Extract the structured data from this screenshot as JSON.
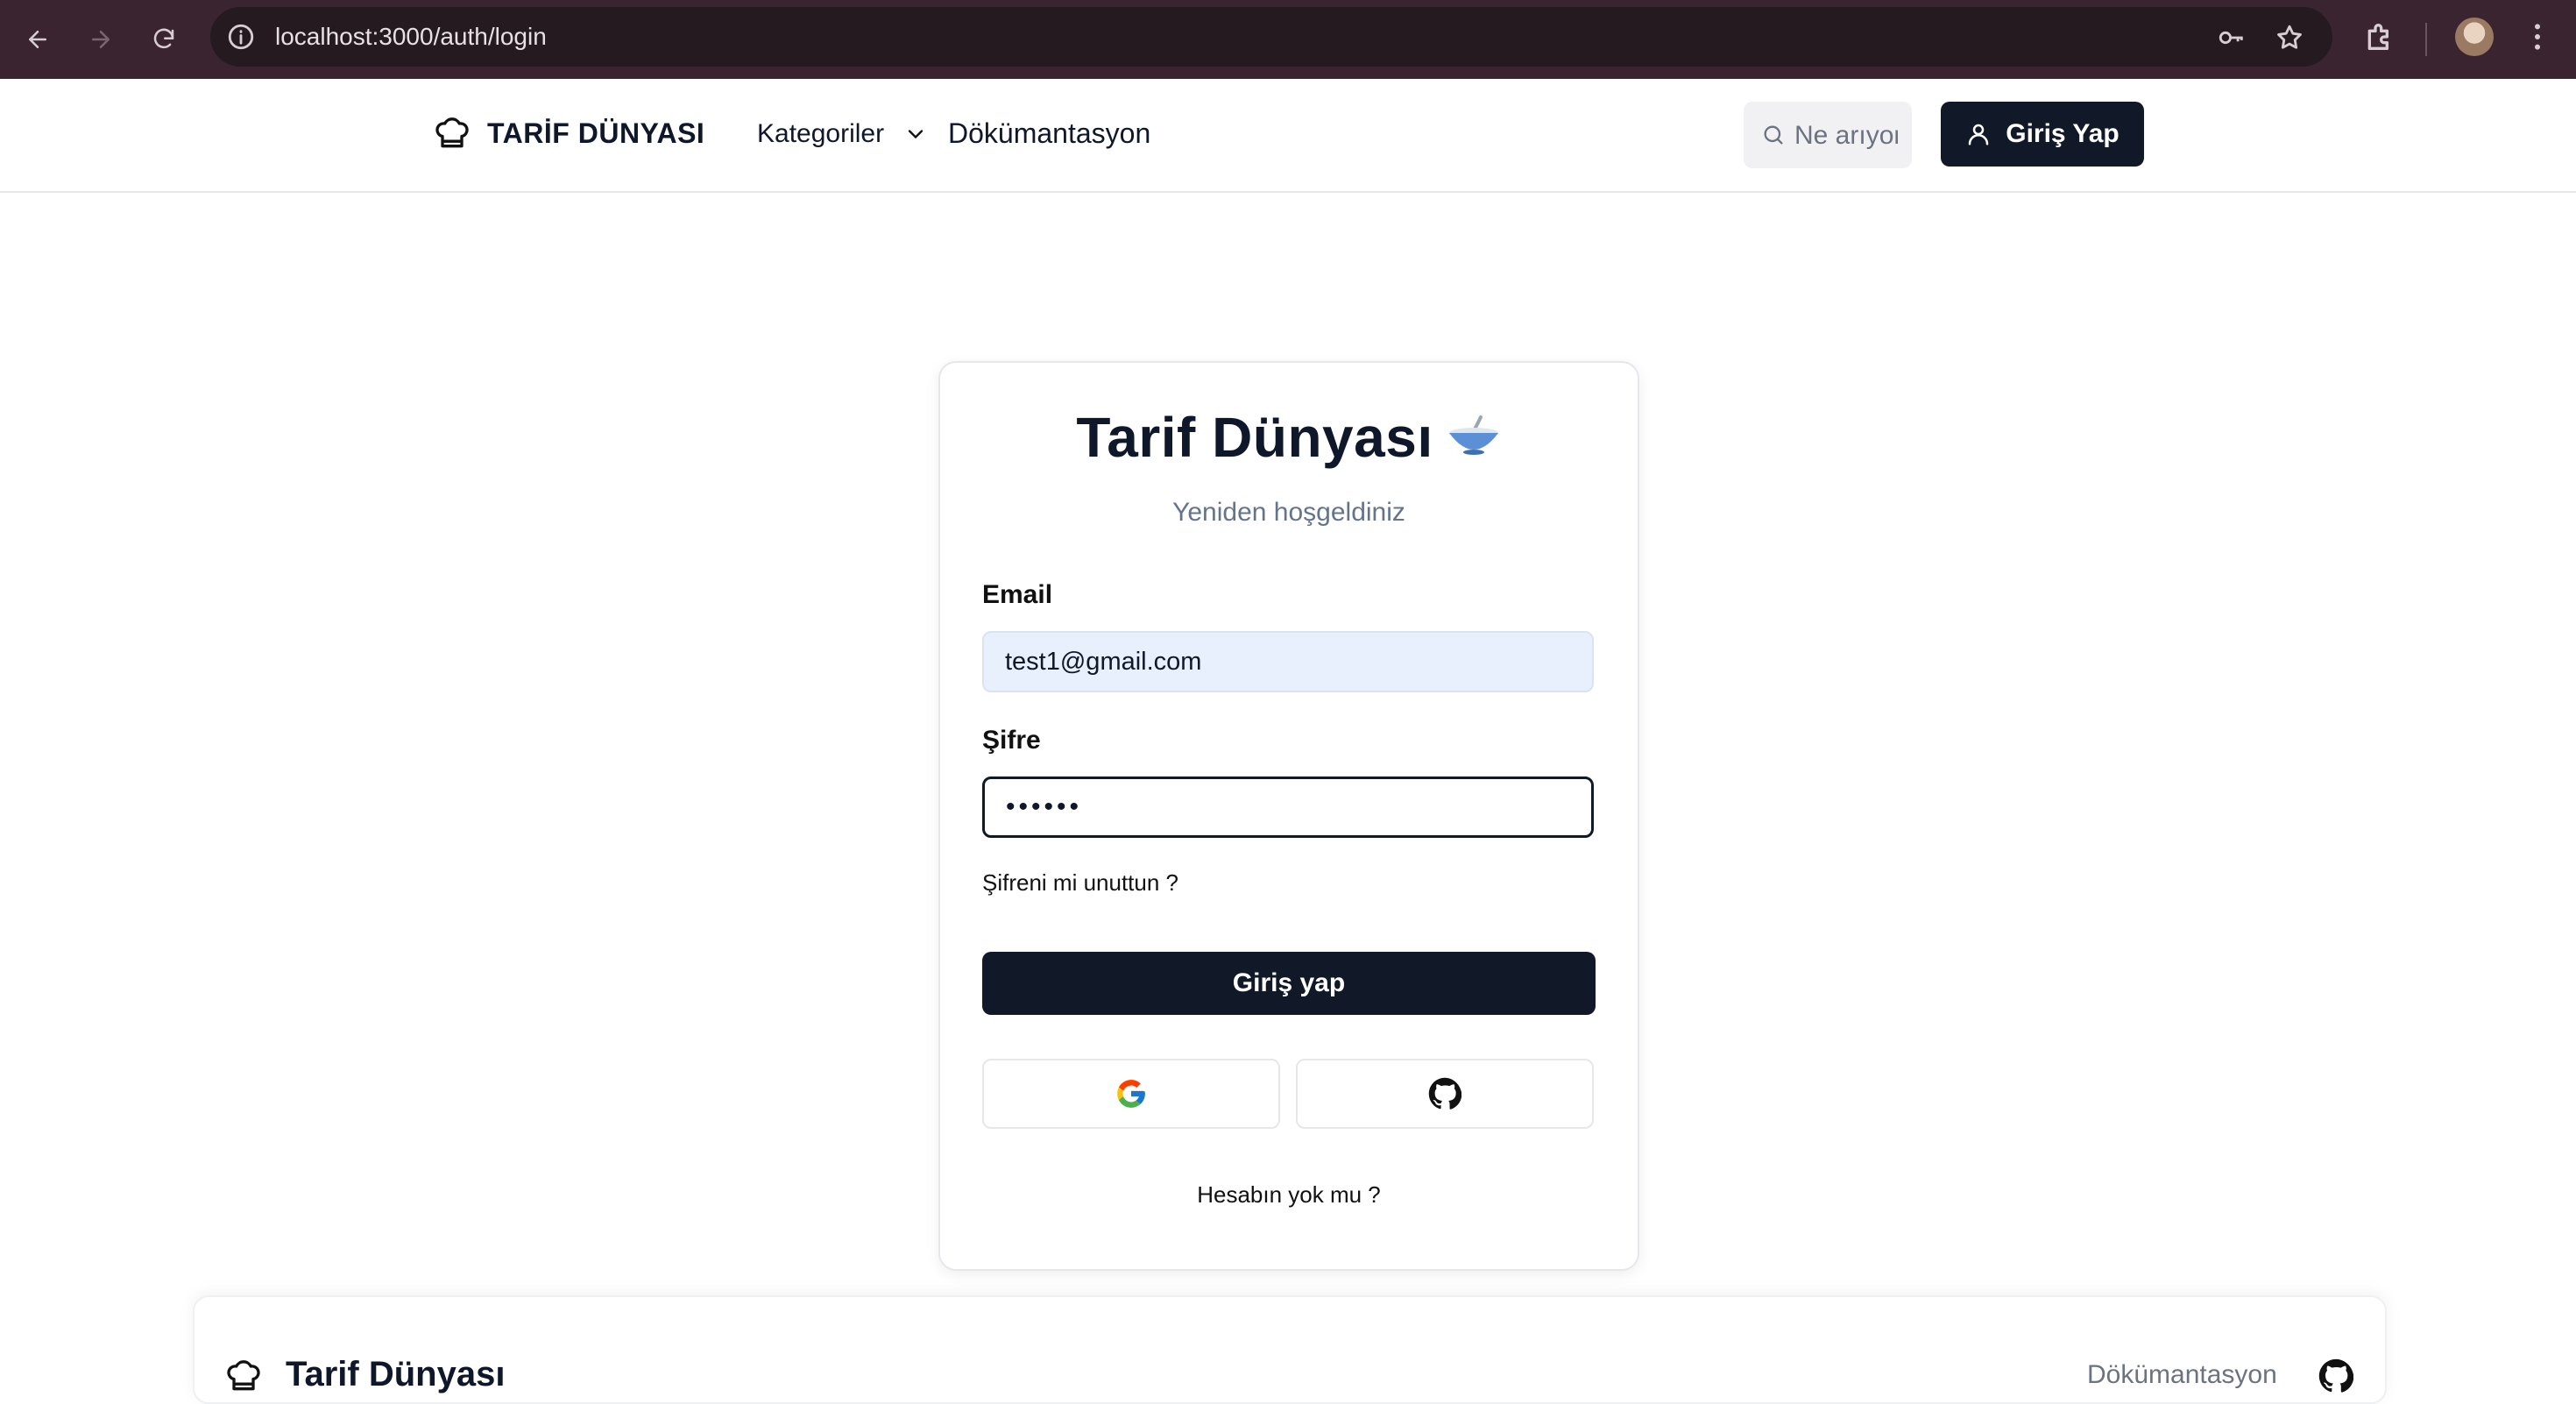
{
  "browser": {
    "url": "localhost:3000/auth/login",
    "icons": [
      "back-arrow-icon",
      "forward-arrow-icon",
      "reload-icon",
      "site-info-icon",
      "password-key-icon",
      "bookmark-star-icon",
      "extensions-icon",
      "profile-avatar",
      "more-menu-icon"
    ]
  },
  "header": {
    "logo_text": "TARİF DÜNYASI",
    "nav_categories": "Kategoriler",
    "nav_docs": "Dökümantasyon",
    "search_placeholder": "Ne arıyorsun?",
    "login_button": "Giriş Yap"
  },
  "login_card": {
    "title": "Tarif Dünyası",
    "subtitle": "Yeniden hoşgeldiniz",
    "email_label": "Email",
    "email_value": "test1@gmail.com",
    "password_label": "Şifre",
    "password_value": "••••••",
    "forgot_link": "Şifreni mi unuttun ?",
    "submit_button": "Giriş yap",
    "no_account_link": "Hesabın yok mu ?"
  },
  "footer": {
    "title": "Tarif Dünyası",
    "docs_link": "Dökümantasyon"
  },
  "colors": {
    "chrome_bg": "#3a2430",
    "primary_dark": "#111827",
    "email_autofill_bg": "#e8f0fe",
    "muted_text": "#64748b"
  }
}
